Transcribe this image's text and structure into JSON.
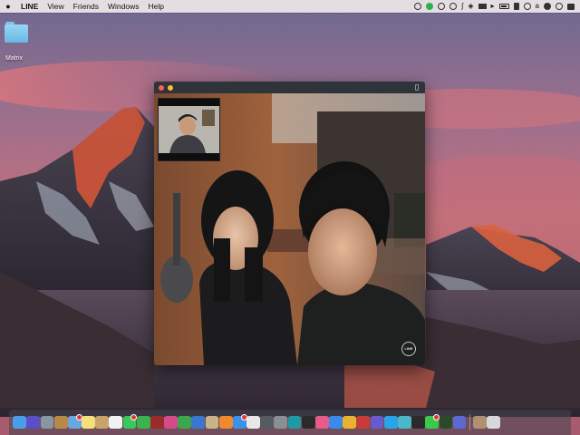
{
  "menubar": {
    "apple_icon": "apple-icon",
    "items": [
      "LINE",
      "View",
      "Friends",
      "Windows",
      "Help"
    ],
    "status_icons": [
      "record-icon",
      "line-status-icon",
      "sync-icon",
      "time-machine-icon",
      "bluetooth-icon",
      "wifi-icon",
      "airplay-icon",
      "volume-icon",
      "battery-icon",
      "notes-icon",
      "clock-icon"
    ],
    "status_letter": "a",
    "status_extra": [
      "user-icon",
      "search-icon",
      "notification-center-icon"
    ]
  },
  "desktop": {
    "icons": [
      {
        "label": "Matrix",
        "icon": "folder-icon"
      }
    ]
  },
  "call_window": {
    "title": "",
    "badge_text": "LINE",
    "colors": {
      "titlebar": "#2e3439",
      "close": "#fc5f57",
      "minimize": "#fdbc2e"
    }
  },
  "dock": {
    "apps": [
      {
        "icon": "finder-icon",
        "color": "#4a9ee8",
        "badge": false
      },
      {
        "icon": "siri-icon",
        "color": "#5a4fc9",
        "badge": false
      },
      {
        "icon": "launchpad-icon",
        "color": "#8a95a3",
        "badge": false
      },
      {
        "icon": "notebook-icon",
        "color": "#b88a4a",
        "badge": false
      },
      {
        "icon": "mail-icon",
        "color": "#6aa7e0",
        "badge": true
      },
      {
        "icon": "notes-icon",
        "color": "#f4e07a",
        "badge": false
      },
      {
        "icon": "contacts-icon",
        "color": "#c9a36a",
        "badge": false
      },
      {
        "icon": "calendar-icon",
        "color": "#f2f2f2",
        "badge": false
      },
      {
        "icon": "messages-icon",
        "color": "#37c95a",
        "badge": true
      },
      {
        "icon": "facetime-icon",
        "color": "#3bb24b",
        "badge": false
      },
      {
        "icon": "photo-booth-icon",
        "color": "#9a2b2b",
        "badge": false
      },
      {
        "icon": "itunes-icon",
        "color": "#d64a8a",
        "badge": false
      },
      {
        "icon": "numbers-icon",
        "color": "#3aa84a",
        "badge": false
      },
      {
        "icon": "keynote-icon",
        "color": "#3a78d0",
        "badge": false
      },
      {
        "icon": "preview-icon",
        "color": "#c9b48a",
        "badge": false
      },
      {
        "icon": "books-icon",
        "color": "#f0882e",
        "badge": false
      },
      {
        "icon": "app-store-icon",
        "color": "#3a92e8",
        "badge": true
      },
      {
        "icon": "photos-icon",
        "color": "#e8e8e8",
        "badge": false
      },
      {
        "icon": "screenshot-icon",
        "color": "#555a62",
        "badge": false
      },
      {
        "icon": "help-icon",
        "color": "#8a8f96",
        "badge": false
      },
      {
        "icon": "arduino-icon",
        "color": "#1f9aa5",
        "badge": false
      },
      {
        "icon": "terminal-icon",
        "color": "#2a2a2a",
        "badge": false
      },
      {
        "icon": "music-icon",
        "color": "#e85a8a",
        "badge": false
      },
      {
        "icon": "safari-icon",
        "color": "#3a8ae8",
        "badge": false
      },
      {
        "icon": "chrome-icon",
        "color": "#e8b42e",
        "badge": false
      },
      {
        "icon": "color-picker-icon",
        "color": "#c93a3a",
        "badge": false
      },
      {
        "icon": "star-icon",
        "color": "#6a5ad0",
        "badge": false
      },
      {
        "icon": "skype-icon",
        "color": "#2aa4e8",
        "badge": false
      },
      {
        "icon": "stocks-icon",
        "color": "#4ab8c9",
        "badge": false
      },
      {
        "icon": "spotify-icon",
        "color": "#2a2a2a",
        "badge": false
      },
      {
        "icon": "line-icon",
        "color": "#3ac94a",
        "badge": true
      },
      {
        "icon": "dictionary-icon",
        "color": "#2a4a2a",
        "badge": false
      },
      {
        "icon": "discord-icon",
        "color": "#5a6ad0",
        "badge": false
      }
    ],
    "trailing": [
      {
        "icon": "downloads-stack-icon",
        "color": "#b09070"
      },
      {
        "icon": "trash-icon",
        "color": "#d8d8dc"
      }
    ]
  }
}
